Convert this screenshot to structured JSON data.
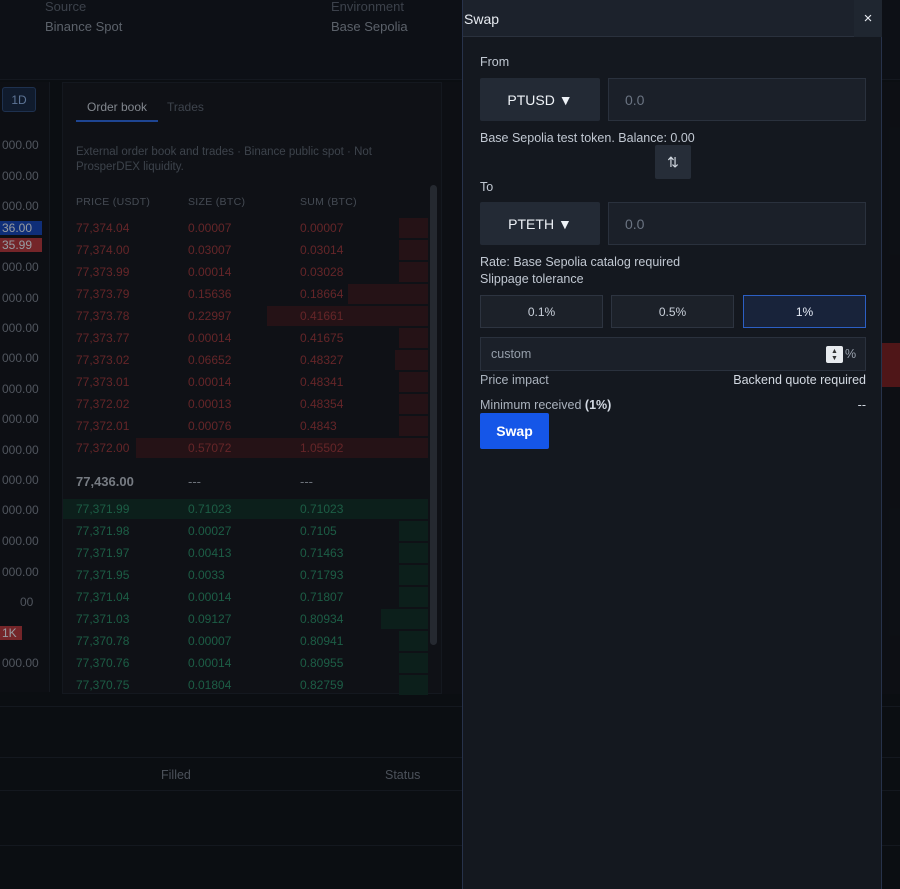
{
  "background": {
    "source_label": "Source",
    "source_value": "Binance Spot",
    "environment_label": "Environment",
    "environment_value": "Base Sepolia",
    "timeframe": "1D",
    "axis_labels": [
      "000.00",
      "000.00",
      "000.00",
      "000.00",
      "000.00",
      "000.00",
      "000.00",
      "000.00",
      "000.00",
      "000.00",
      "000.00",
      "000.00",
      "000.00",
      "000.00",
      "00",
      "000.00"
    ],
    "axis_tag_blue": "36.00",
    "axis_tag_red": "35.99",
    "axis_tag_volume": "1K",
    "colors": {
      "tag_blue": "#1747b8",
      "tag_red": "#b23a3f"
    }
  },
  "orderbook": {
    "tabs": [
      "Order book",
      "Trades"
    ],
    "note": "External order book and trades · Binance public spot · Not ProsperDEX liquidity.",
    "columns": [
      "PRICE (USDT)",
      "SIZE (BTC)",
      "SUM (BTC)"
    ],
    "asks": [
      {
        "price": "77,374.04",
        "size": "0.00007",
        "sum": "0.00007",
        "depth": 0.08
      },
      {
        "price": "77,374.00",
        "size": "0.03007",
        "sum": "0.03014",
        "depth": 0.08
      },
      {
        "price": "77,373.99",
        "size": "0.00014",
        "sum": "0.03028",
        "depth": 0.08
      },
      {
        "price": "77,373.79",
        "size": "0.15636",
        "sum": "0.18664",
        "depth": 0.22
      },
      {
        "price": "77,373.78",
        "size": "0.22997",
        "sum": "0.41661",
        "depth": 0.44
      },
      {
        "price": "77,373.77",
        "size": "0.00014",
        "sum": "0.41675",
        "depth": 0.08
      },
      {
        "price": "77,373.02",
        "size": "0.06652",
        "sum": "0.48327",
        "depth": 0.09
      },
      {
        "price": "77,373.01",
        "size": "0.00014",
        "sum": "0.48341",
        "depth": 0.08
      },
      {
        "price": "77,372.02",
        "size": "0.00013",
        "sum": "0.48354",
        "depth": 0.08
      },
      {
        "price": "77,372.01",
        "size": "0.00076",
        "sum": "0.4843",
        "depth": 0.08
      },
      {
        "price": "77,372.00",
        "size": "0.57072",
        "sum": "1.05502",
        "depth": 0.8
      }
    ],
    "mid": {
      "price": "77,436.00",
      "size": "---",
      "sum": "---"
    },
    "bids": [
      {
        "price": "77,371.99",
        "size": "0.71023",
        "sum": "0.71023",
        "depth": 1.0
      },
      {
        "price": "77,371.98",
        "size": "0.00027",
        "sum": "0.7105",
        "depth": 0.08
      },
      {
        "price": "77,371.97",
        "size": "0.00413",
        "sum": "0.71463",
        "depth": 0.08
      },
      {
        "price": "77,371.95",
        "size": "0.0033",
        "sum": "0.71793",
        "depth": 0.08
      },
      {
        "price": "77,371.04",
        "size": "0.00014",
        "sum": "0.71807",
        "depth": 0.08
      },
      {
        "price": "77,371.03",
        "size": "0.09127",
        "sum": "0.80934",
        "depth": 0.13
      },
      {
        "price": "77,370.78",
        "size": "0.00007",
        "sum": "0.80941",
        "depth": 0.08
      },
      {
        "price": "77,370.76",
        "size": "0.00014",
        "sum": "0.80955",
        "depth": 0.08
      },
      {
        "price": "77,370.75",
        "size": "0.01804",
        "sum": "0.82759",
        "depth": 0.08
      }
    ]
  },
  "orders_table": {
    "columns": [
      "Filled",
      "Status"
    ]
  },
  "swap": {
    "title": "Swap",
    "close_label": "×",
    "from_label": "From",
    "from_token": "PTUSD ▼",
    "from_amount_placeholder": "0.0",
    "from_note": "Base Sepolia test token. Balance: 0.00",
    "flip_icon": "⇅",
    "to_label": "To",
    "to_token": "PTETH ▼",
    "to_amount_placeholder": "0.0",
    "rate": "Rate: Base Sepolia catalog required",
    "slippage_label": "Slippage tolerance",
    "slippage_options": [
      "0.1%",
      "0.5%",
      "1%"
    ],
    "slippage_selected": "1%",
    "custom_placeholder": "custom",
    "custom_unit": "%",
    "price_impact_label": "Price impact",
    "price_impact_value": "Backend quote required",
    "min_received_label": "Minimum received",
    "min_received_pct": "(1%)",
    "min_received_value": "--",
    "submit_label": "Swap",
    "colors": {
      "primary": "#1556e8",
      "selected_border": "#2c5fc4"
    }
  }
}
